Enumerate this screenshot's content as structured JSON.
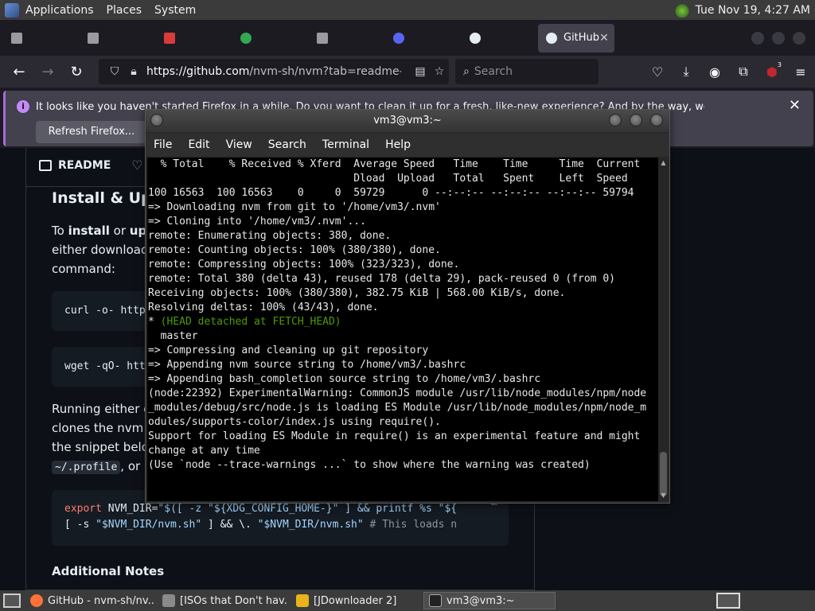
{
  "top_panel": {
    "menus": [
      "Applications",
      "Places",
      "System"
    ],
    "clock": "Tue Nov 19,  4:27 AM"
  },
  "tabs": [
    {
      "label": "",
      "color": "#9a9aa3"
    },
    {
      "label": "",
      "color": "#9a9aa3"
    },
    {
      "label": "",
      "color": "#d93b3b"
    },
    {
      "label": "",
      "color": "#34a853"
    },
    {
      "label": "",
      "color": "#9a9aa3"
    },
    {
      "label": "",
      "color": "#5865f2"
    },
    {
      "label": "",
      "color": "#e6edf3"
    },
    {
      "label": "GitHub",
      "color": "#e6edf3",
      "active": true
    }
  ],
  "navbar": {
    "url_host": "https://github.com",
    "url_path": "/nvm-sh/nvm?tab=readme-ov-",
    "search_placeholder": "Search",
    "badge": "3"
  },
  "notification": {
    "message": "It looks like you haven't started Firefox in a while. Do you want to clean it up for a fresh, like-new experience? And by the way, welcome back!",
    "button": "Refresh Firefox..."
  },
  "readme": {
    "tab_label": "README",
    "heading": "Install & Upd",
    "p1_line1_pre": "To ",
    "p1_line1_b1": "install",
    "p1_line1_mid": " or ",
    "p1_line1_b2": "upd",
    "p1_line2": "either download",
    "p1_line3": "command:",
    "code1": "curl -o- http",
    "code2": "wget -qO- htt",
    "p2_line1": "Running either o",
    "p2_line2": "clones the nvm r",
    "p2_line3": "the snippet belov",
    "p2_line4_code": "~/.profile",
    "p2_line4_rest": ", or",
    "export_line1_kw": "export",
    "export_line1_a": " NVM_DIR=",
    "export_line1_b": "\"$([ -z \"${XDG_CONFIG_HOME-}\" ] && printf %s \"${",
    "export_line2_a": "[ -s ",
    "export_line2_b": "\"$NVM_DIR/nvm.sh\"",
    "export_line2_c": " ] && \\. ",
    "export_line2_d": "\"$NVM_DIR/nvm.sh\"",
    "export_line2_e": " # This loads n",
    "notes_heading": "Additional Notes"
  },
  "terminal": {
    "title": "vm3@vm3:~",
    "menu": [
      "File",
      "Edit",
      "View",
      "Search",
      "Terminal",
      "Help"
    ],
    "lines": [
      "  % Total    % Received % Xferd  Average Speed   Time    Time     Time  Current",
      "                                 Dload  Upload   Total   Spent    Left  Speed",
      "100 16563  100 16563    0     0  59729      0 --:--:-- --:--:-- --:--:-- 59794",
      "=> Downloading nvm from git to '/home/vm3/.nvm'",
      "=> Cloning into '/home/vm3/.nvm'...",
      "remote: Enumerating objects: 380, done.",
      "remote: Counting objects: 100% (380/380), done.",
      "remote: Compressing objects: 100% (323/323), done.",
      "remote: Total 380 (delta 43), reused 178 (delta 29), pack-reused 0 (from 0)",
      "Receiving objects: 100% (380/380), 382.75 KiB | 568.00 KiB/s, done.",
      "Resolving deltas: 100% (43/43), done."
    ],
    "head_star": "* ",
    "head_detached": "(HEAD detached at FETCH_HEAD)",
    "lines2": [
      "  master",
      "=> Compressing and cleaning up git repository",
      "",
      "=> Appending nvm source string to /home/vm3/.bashrc",
      "=> Appending bash_completion source string to /home/vm3/.bashrc",
      "(node:22392) ExperimentalWarning: CommonJS module /usr/lib/node_modules/npm/node",
      "_modules/debug/src/node.js is loading ES Module /usr/lib/node_modules/npm/node_m",
      "odules/supports-color/index.js using require().",
      "Support for loading ES Module in require() is an experimental feature and might",
      "change at any time",
      "(Use `node --trace-warnings ...` to show where the warning was created)"
    ]
  },
  "taskbar": {
    "tasks": [
      {
        "label": "GitHub - nvm-sh/nv...",
        "color": "#ff7139"
      },
      {
        "label": "[ISOs that Don't hav...",
        "color": "#8a8a8a"
      },
      {
        "label": "[JDownloader 2]",
        "color": "#e8b31b"
      },
      {
        "label": "vm3@vm3:~",
        "color": "#222222",
        "active": true
      }
    ]
  }
}
